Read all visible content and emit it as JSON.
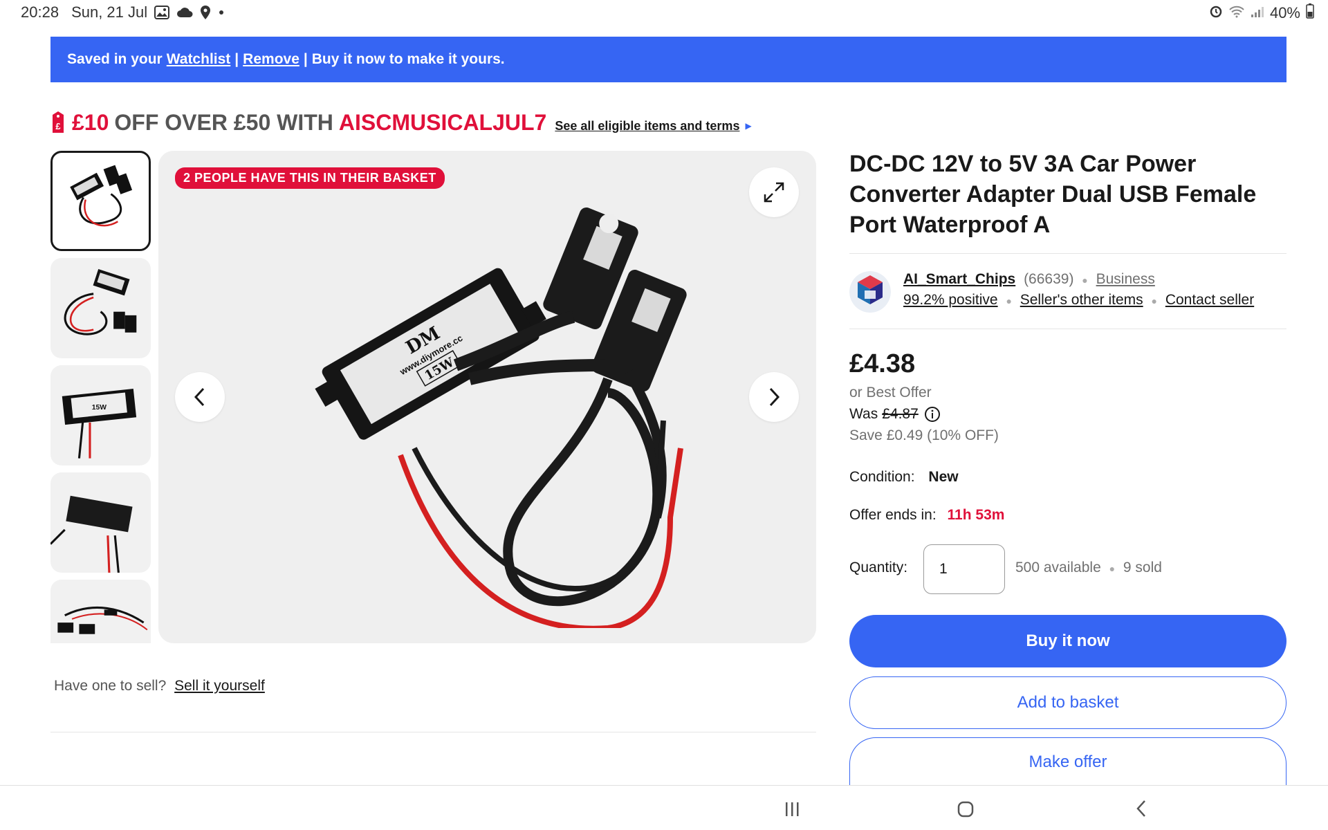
{
  "status_bar": {
    "time": "20:28",
    "date": "Sun, 21 Jul",
    "battery": "40%",
    "icons": [
      "gallery-icon",
      "cloud-icon",
      "location-icon",
      "alarm-icon",
      "wifi-icon",
      "signal-icon",
      "battery-icon"
    ]
  },
  "banner": {
    "prefix": "Saved in your",
    "watchlist_link": "Watchlist",
    "separator": "|",
    "remove_link": "Remove",
    "suffix": "Buy it now to make it yours.",
    "bg_color": "#3665f3"
  },
  "promo": {
    "amount": "£10",
    "middle": "OFF OVER £50 WITH",
    "code": "AISCMUSICALJUL7",
    "link": "See all eligible items and terms",
    "accent_color": "#e0103a"
  },
  "gallery": {
    "badge": "2 PEOPLE HAVE THIS IN THEIR BASKET",
    "thumbnail_count": 5,
    "selected_thumbnail": 1
  },
  "sell": {
    "question": "Have one to sell?",
    "link": "Sell it yourself"
  },
  "product": {
    "title": "DC-DC 12V to 5V 3A Car Power Converter Adapter Dual USB Female Port Waterproof A",
    "price": "£4.38",
    "best_offer": "or Best Offer",
    "was_label": "Was",
    "was_price": "£4.87",
    "save_text": "Save £0.49 (10% OFF)",
    "condition_label": "Condition:",
    "condition_value": "New",
    "offer_label": "Offer ends in:",
    "offer_value": "11h 53m",
    "quantity_label": "Quantity:",
    "quantity_value": "1",
    "available": "500 available",
    "sold": "9 sold"
  },
  "seller": {
    "name": "AI_Smart_Chips",
    "feedback_count": "(66639)",
    "type": "Business",
    "positive": "99.2% positive",
    "other_items": "Seller's other items",
    "contact": "Contact seller"
  },
  "actions": {
    "buy_now": "Buy it now",
    "add_basket": "Add to basket",
    "make_offer": "Make offer",
    "primary_color": "#3665f3"
  }
}
